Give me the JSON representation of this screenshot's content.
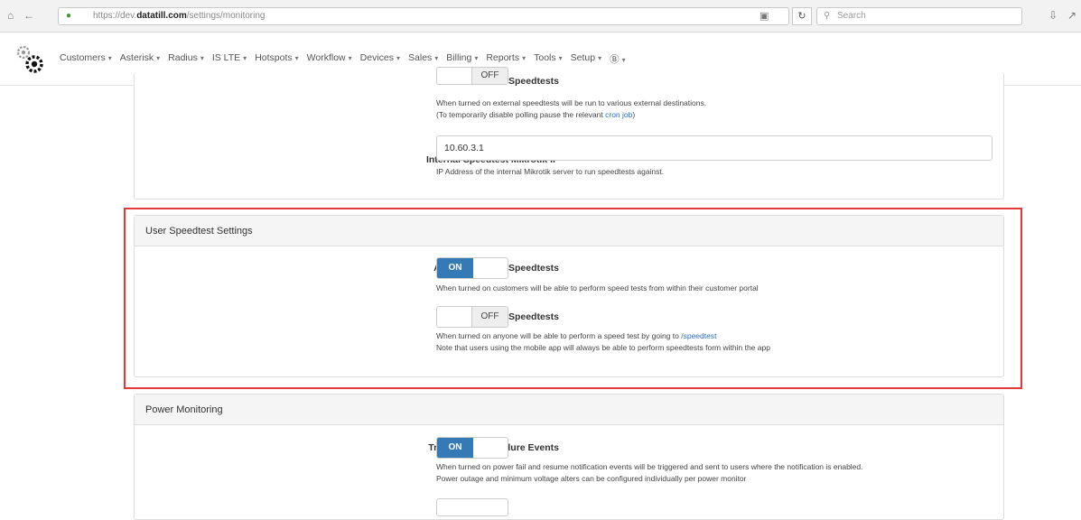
{
  "browser": {
    "url_prefix": "https://dev.",
    "url_domain": "datatill.com",
    "url_path": "/settings/monitoring",
    "search_placeholder": "Search"
  },
  "nav": {
    "items": [
      "Customers",
      "Asterisk",
      "Radius",
      "IS LTE",
      "Hotspots",
      "Workflow",
      "Devices",
      "Sales",
      "Billing",
      "Reports",
      "Tools",
      "Setup",
      "Ⓑ"
    ]
  },
  "top_panel": {
    "run_external_label": "Run External Speedtests",
    "run_external_toggle": "OFF",
    "run_external_help1": "When turned on external speedtests will be run to various external destinations.",
    "run_external_help2_pre": "(To temporarily disable polling pause the relevant ",
    "run_external_help2_link": "cron job",
    "run_external_help2_post": ")",
    "internal_ip_label": "Internal Speedtest Mikrotik IP",
    "internal_ip_value": "10.60.3.1",
    "internal_ip_help": "IP Address of the internal Mikrotik server to run speedtests against."
  },
  "user_speedtest": {
    "heading": "User Speedtest Settings",
    "allow_customer_label": "Allow Customer Speedtests",
    "allow_customer_toggle": "ON",
    "allow_customer_help": "When turned on customers will be able to perform speed tests from within their customer portal",
    "allow_public_label": "Allow Public Speedtests",
    "allow_public_toggle": "OFF",
    "allow_public_help1_pre": "When turned on anyone will be able to perform a speed test by going to ",
    "allow_public_help1_link": "/speedtest",
    "allow_public_help2": "Note that users using the mobile app will always be able to perform speedtests form within the app"
  },
  "power_monitoring": {
    "heading": "Power Monitoring",
    "trigger_label": "Trigger Power Failure Events",
    "trigger_toggle": "ON",
    "trigger_help1": "When turned on power fail and resume notification events will be triggered and sent to users where the notification is enabled.",
    "trigger_help2": "Power outage and minimum voltage alters can be configured individually per power monitor"
  },
  "colors": {
    "accent": "#337ab7",
    "highlight": "#e03a3a"
  }
}
